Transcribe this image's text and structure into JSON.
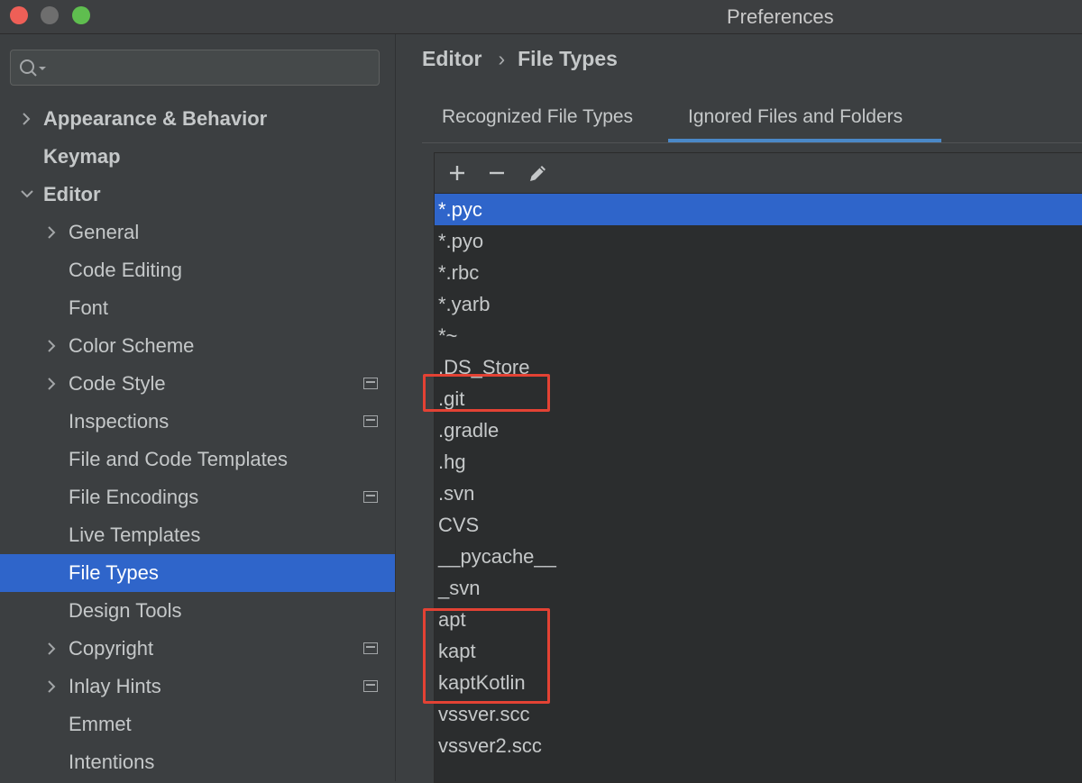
{
  "window": {
    "title": "Preferences"
  },
  "search": {
    "placeholder": "",
    "value": ""
  },
  "sidebar": {
    "items": [
      {
        "label": "Appearance & Behavior",
        "level": 0,
        "chevron": "right",
        "bold": true,
        "icon": false,
        "selected": false
      },
      {
        "label": "Keymap",
        "level": 0,
        "chevron": "none",
        "bold": true,
        "icon": false,
        "selected": false
      },
      {
        "label": "Editor",
        "level": 0,
        "chevron": "down",
        "bold": true,
        "icon": false,
        "selected": false
      },
      {
        "label": "General",
        "level": 1,
        "chevron": "right",
        "bold": false,
        "icon": false,
        "selected": false
      },
      {
        "label": "Code Editing",
        "level": 1,
        "chevron": "none",
        "bold": false,
        "icon": false,
        "selected": false
      },
      {
        "label": "Font",
        "level": 1,
        "chevron": "none",
        "bold": false,
        "icon": false,
        "selected": false
      },
      {
        "label": "Color Scheme",
        "level": 1,
        "chevron": "right",
        "bold": false,
        "icon": false,
        "selected": false
      },
      {
        "label": "Code Style",
        "level": 1,
        "chevron": "right",
        "bold": false,
        "icon": true,
        "selected": false
      },
      {
        "label": "Inspections",
        "level": 1,
        "chevron": "none",
        "bold": false,
        "icon": true,
        "selected": false
      },
      {
        "label": "File and Code Templates",
        "level": 1,
        "chevron": "none",
        "bold": false,
        "icon": false,
        "selected": false
      },
      {
        "label": "File Encodings",
        "level": 1,
        "chevron": "none",
        "bold": false,
        "icon": true,
        "selected": false
      },
      {
        "label": "Live Templates",
        "level": 1,
        "chevron": "none",
        "bold": false,
        "icon": false,
        "selected": false
      },
      {
        "label": "File Types",
        "level": 1,
        "chevron": "none",
        "bold": false,
        "icon": false,
        "selected": true
      },
      {
        "label": "Design Tools",
        "level": 1,
        "chevron": "none",
        "bold": false,
        "icon": false,
        "selected": false
      },
      {
        "label": "Copyright",
        "level": 1,
        "chevron": "right",
        "bold": false,
        "icon": true,
        "selected": false
      },
      {
        "label": "Inlay Hints",
        "level": 1,
        "chevron": "right",
        "bold": false,
        "icon": true,
        "selected": false
      },
      {
        "label": "Emmet",
        "level": 1,
        "chevron": "none",
        "bold": false,
        "icon": false,
        "selected": false
      },
      {
        "label": "Intentions",
        "level": 1,
        "chevron": "none",
        "bold": false,
        "icon": false,
        "selected": false
      }
    ]
  },
  "breadcrumb": {
    "parent": "Editor",
    "separator": "›",
    "current": "File Types"
  },
  "tabs": [
    {
      "label": "Recognized File Types",
      "active": false
    },
    {
      "label": "Ignored Files and Folders",
      "active": true
    }
  ],
  "toolbar": {
    "add_icon": "plus-icon",
    "remove_icon": "minus-icon",
    "edit_icon": "pencil-icon"
  },
  "ignored_items": [
    {
      "label": "*.pyc",
      "selected": true
    },
    {
      "label": "*.pyo",
      "selected": false
    },
    {
      "label": "*.rbc",
      "selected": false
    },
    {
      "label": "*.yarb",
      "selected": false
    },
    {
      "label": "*~",
      "selected": false
    },
    {
      "label": ".DS_Store",
      "selected": false
    },
    {
      "label": ".git",
      "selected": false
    },
    {
      "label": ".gradle",
      "selected": false
    },
    {
      "label": ".hg",
      "selected": false
    },
    {
      "label": ".svn",
      "selected": false
    },
    {
      "label": "CVS",
      "selected": false
    },
    {
      "label": "__pycache__",
      "selected": false
    },
    {
      "label": "_svn",
      "selected": false
    },
    {
      "label": "apt",
      "selected": false
    },
    {
      "label": "kapt",
      "selected": false
    },
    {
      "label": "kaptKotlin",
      "selected": false
    },
    {
      "label": "vssver.scc",
      "selected": false
    },
    {
      "label": "vssver2.scc",
      "selected": false
    }
  ],
  "colors": {
    "selection": "#2f65ca",
    "highlight_box": "#e34234",
    "tab_underline": "#4a88c7",
    "background": "#3c3f41"
  }
}
